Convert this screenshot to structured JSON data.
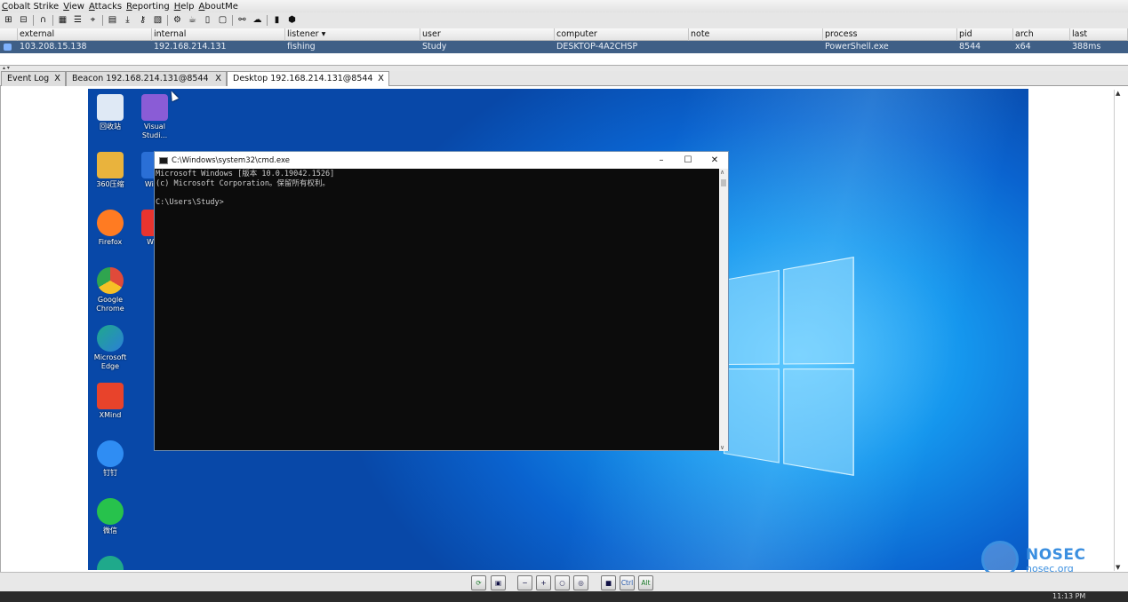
{
  "menu": [
    "Cobalt Strike",
    "View",
    "Attacks",
    "Reporting",
    "Help",
    "AboutMe"
  ],
  "toolbar_icons": [
    "connect-icon",
    "disconnect-icon",
    "headphones-icon",
    "pivot-graph-icon",
    "session-list-icon",
    "target-icon",
    "credentials-icon",
    "download-icon",
    "key-icon",
    "screenshot-icon",
    "settings-icon",
    "coffee-icon",
    "document-icon",
    "console-icon",
    "link-icon",
    "cloud-icon",
    "book-icon",
    "cube-icon"
  ],
  "table": {
    "columns": [
      "external",
      "internal",
      "listener ▾",
      "user",
      "computer",
      "note",
      "process",
      "pid",
      "arch",
      "last"
    ],
    "rows": [
      [
        "103.208.15.138",
        "192.168.214.131",
        "fishing",
        "Study",
        "DESKTOP-4A2CHSP",
        "",
        "PowerShell.exe",
        "8544",
        "x64",
        "388ms"
      ]
    ]
  },
  "split_handle": "▴ ▾",
  "tabs": [
    {
      "label": "Event Log",
      "active": false
    },
    {
      "label": "Beacon 192.168.214.131@8544",
      "active": false
    },
    {
      "label": "Desktop 192.168.214.131@8544",
      "active": true
    }
  ],
  "tab_close": "X",
  "desktop_icons": [
    {
      "label": "回收站",
      "icon": "recycle-bin-icon",
      "color": "#dfe9f5"
    },
    {
      "label": "Visual Studi...",
      "icon": "visual-studio-icon",
      "color": "#8a5cd6"
    },
    {
      "label": "360压缩",
      "icon": "360-zip-icon",
      "color": "#e9b33d"
    },
    {
      "label": "Wires",
      "icon": "wireshark-icon",
      "color": "#2a6fd6"
    },
    {
      "label": "Firefox",
      "icon": "firefox-icon",
      "color": "#ff7b22"
    },
    {
      "label": "WPS",
      "icon": "wps-icon",
      "color": "#e8342f"
    },
    {
      "label": "Google Chrome",
      "icon": "chrome-icon",
      "color": "#e04a3a"
    },
    {
      "label": "Microsoft Edge",
      "icon": "edge-icon",
      "color": "#1fa98b"
    },
    {
      "label": "XMind",
      "icon": "xmind-icon",
      "color": "#e8432b"
    },
    {
      "label": "钉钉",
      "icon": "dingtalk-icon",
      "color": "#2f8df3"
    },
    {
      "label": "微信",
      "icon": "wechat-icon",
      "color": "#27c24c"
    }
  ],
  "cmd": {
    "title": "C:\\Windows\\system32\\cmd.exe",
    "controls": [
      "–",
      "☐",
      "✕"
    ],
    "lines": [
      "Microsoft Windows [版本 10.0.19042.1526]",
      "(c) Microsoft Corporation。保留所有权利。",
      "",
      "C:\\Users\\Study>"
    ]
  },
  "bottom_toolbar": [
    {
      "name": "refresh-button",
      "label": "⟳"
    },
    {
      "name": "agent-button",
      "label": "▣"
    },
    {
      "name": "zoom-out-button",
      "label": "−"
    },
    {
      "name": "zoom-in-button",
      "label": "+"
    },
    {
      "name": "zoom-reset-button",
      "label": "○"
    },
    {
      "name": "zoom-fit-button",
      "label": "◎"
    },
    {
      "name": "screenshot-button",
      "label": "■"
    },
    {
      "name": "ctrl-button",
      "label": "Ctrl"
    },
    {
      "name": "alt-button",
      "label": "Alt"
    }
  ],
  "watermark": {
    "brand": "NOSEC",
    "site": "nosec.org"
  },
  "host_clock": "11:13 PM",
  "colors": {
    "selected_row": "#3f5f86",
    "desktop_blue": "#1597ee",
    "watermark": "#3b8fe0"
  }
}
